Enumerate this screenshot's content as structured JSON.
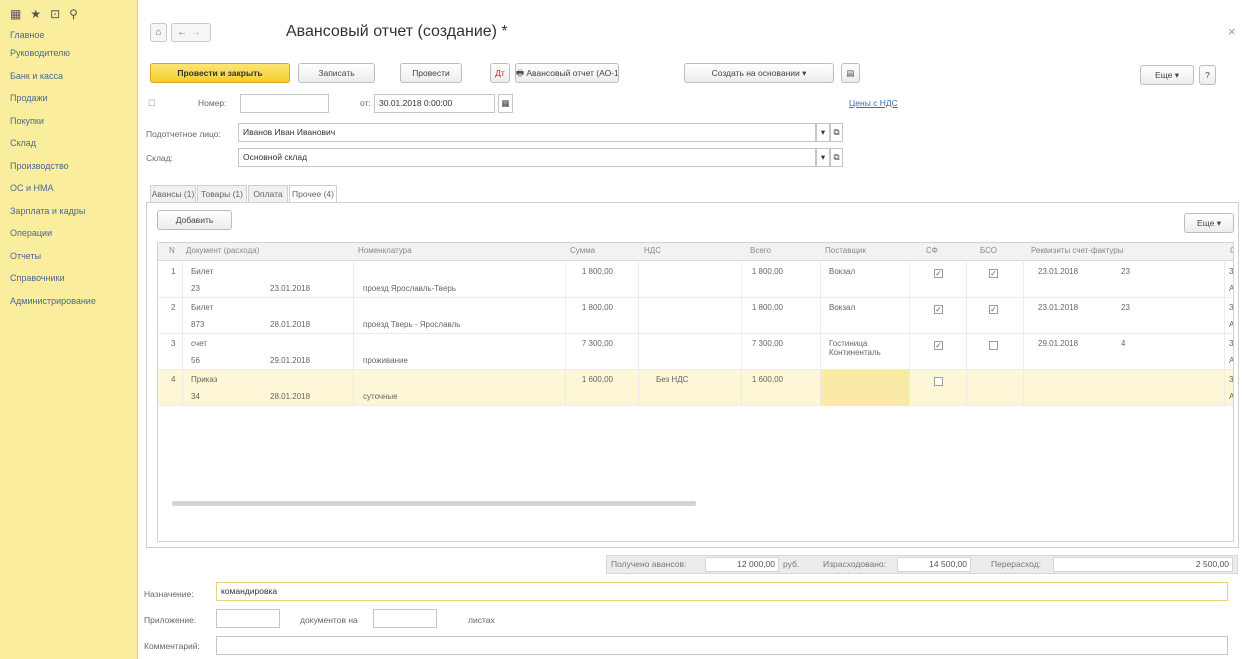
{
  "sidebar": {
    "items": [
      "Главное",
      "Руководителю",
      "Банк и касса",
      "Продажи",
      "Покупки",
      "Склад",
      "Производство",
      "ОС и НМА",
      "Зарплата и кадры",
      "Операции",
      "Отчеты",
      "Справочники",
      "Администрирование"
    ]
  },
  "header": {
    "title": "Авансовый отчет (создание) *",
    "close": "×",
    "home": "⌂",
    "back": "←",
    "fwd": "→"
  },
  "toolbar": {
    "post_close": "Провести и закрыть",
    "save": "Записать",
    "post": "Провести",
    "print": "Авансовый отчет (АО-1)",
    "create_based": "Создать на основании",
    "more": "Еще",
    "help": "?"
  },
  "form": {
    "number_label": "Номер:",
    "number_value": "",
    "date_label": "от:",
    "date_value": "30.01.2018  0:00:00",
    "prices_link": "Цены с НДС",
    "person_label": "Подотчетное лицо:",
    "person_value": "Иванов Иван Иванович",
    "warehouse_label": "Склад:",
    "warehouse_value": "Основной склад"
  },
  "tabs": [
    "Авансы (1)",
    "Товары (1)",
    "Оплата",
    "Прочее (4)"
  ],
  "table": {
    "add_button": "Добавить",
    "more": "Еще",
    "columns": [
      "N",
      "Документ (расхода)",
      "Номенклатура",
      "Сумма",
      "НДС",
      "Всего",
      "Поставщик",
      "СФ",
      "БСО",
      "Реквизиты счет-фактуры",
      "С"
    ],
    "rows": [
      {
        "n": "1",
        "doc": "Билет",
        "num": "23",
        "date": "23.01.2018",
        "nom": "проезд Ярославль-Тверь",
        "sum": "1 800,00",
        "vat": "",
        "total": "1 800,00",
        "supplier": "Вокзал",
        "supplier2": "",
        "sf": true,
        "bso": true,
        "inv_date": "23.01.2018",
        "inv_num": "23",
        "c1": "3",
        "c2": "А"
      },
      {
        "n": "2",
        "doc": "Билет",
        "num": "873",
        "date": "28.01.2018",
        "nom": "проезд Тверь - Ярославль",
        "sum": "1 800,00",
        "vat": "",
        "total": "1 800,00",
        "supplier": "Вокзал",
        "supplier2": "",
        "sf": true,
        "bso": true,
        "inv_date": "23.01.2018",
        "inv_num": "23",
        "c1": "3",
        "c2": "А"
      },
      {
        "n": "3",
        "doc": "счет",
        "num": "56",
        "date": "29.01.2018",
        "nom": "проживание",
        "sum": "7 300,00",
        "vat": "",
        "total": "7 300,00",
        "supplier": "Гостиница",
        "supplier2": "Континенталь",
        "sf": true,
        "bso": false,
        "inv_date": "29.01.2018",
        "inv_num": "4",
        "c1": "3",
        "c2": "А"
      },
      {
        "n": "4",
        "doc": "Приказ",
        "num": "34",
        "date": "28.01.2018",
        "nom": "суточные",
        "sum": "1 600,00",
        "vat": "Без НДС",
        "total": "1 600,00",
        "supplier": "",
        "supplier2": "",
        "sf": false,
        "bso": null,
        "inv_date": "",
        "inv_num": "",
        "c1": "3",
        "c2": "А"
      }
    ]
  },
  "footer": {
    "received_label": "Получено авансов:",
    "received_value": "12 000,00",
    "currency": "руб.",
    "spent_label": "Израсходовано:",
    "spent_value": "14 500,00",
    "overspent_label": "Перерасход:",
    "overspent_value": "2 500,00"
  },
  "bottom": {
    "purpose_label": "Назначение:",
    "purpose_value": "командировка",
    "attach_label": "Приложение:",
    "docs_on": "документов на",
    "sheets": "листах",
    "comment_label": "Комментарий:"
  }
}
